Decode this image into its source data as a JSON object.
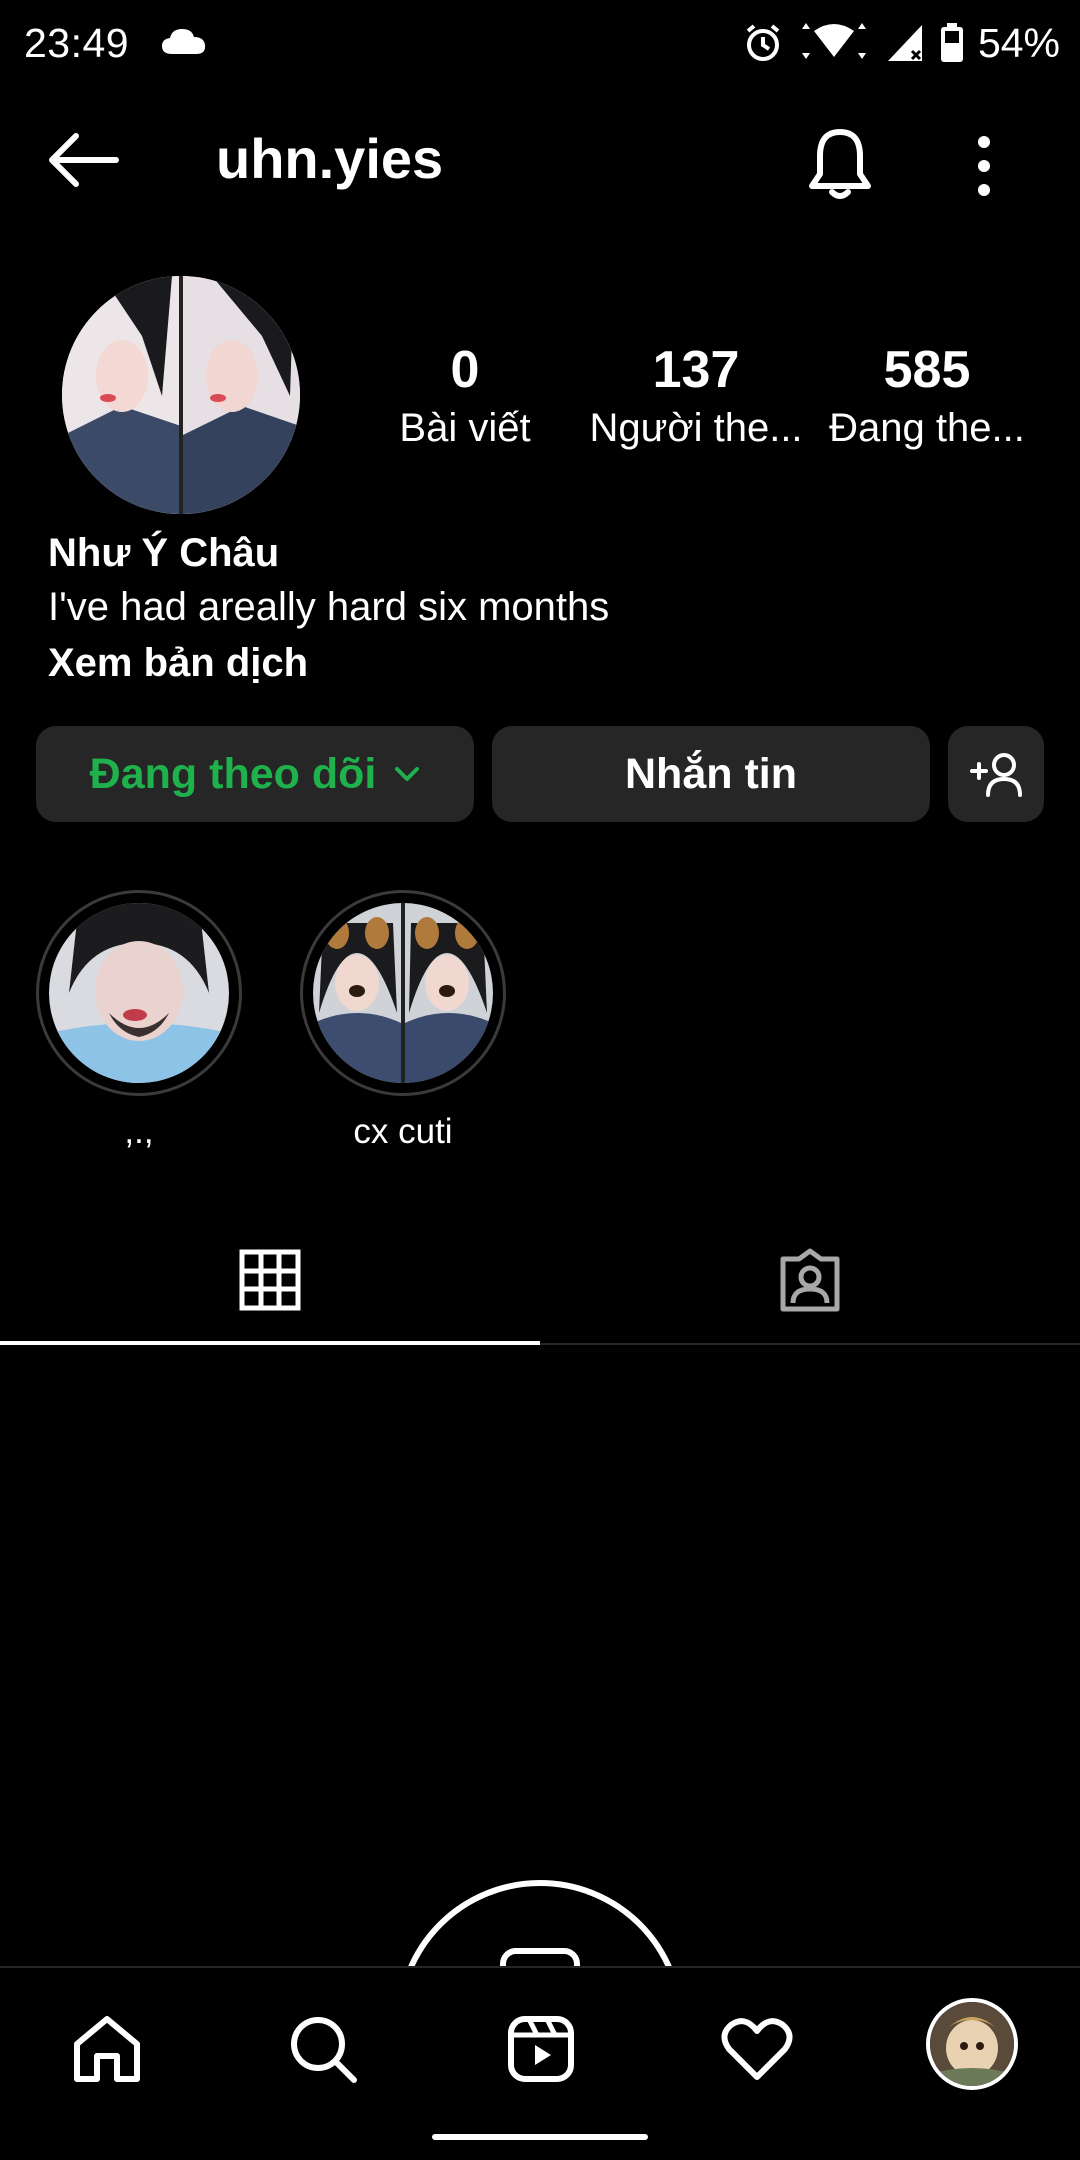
{
  "status_bar": {
    "time": "23:49",
    "battery_percent": "54%",
    "icons": [
      "cloud-icon",
      "alarm-icon",
      "wifi-icon",
      "cell-signal-icon",
      "battery-icon"
    ]
  },
  "header": {
    "username": "uhn.yies",
    "icons": [
      "back-arrow-icon",
      "bell-icon",
      "more-vertical-icon"
    ]
  },
  "profile": {
    "stats": [
      {
        "value": "0",
        "label": "Bài viết"
      },
      {
        "value": "137",
        "label": "Người the..."
      },
      {
        "value": "585",
        "label": "Đang the..."
      }
    ],
    "full_name": "Như Ý Châu",
    "bio": "I've had areally hard six months",
    "translate_label": "Xem bản dịch"
  },
  "actions": {
    "following_label": "Đang theo dõi",
    "message_label": "Nhắn tin"
  },
  "highlights": [
    {
      "label": ",.,"
    },
    {
      "label": "cx cuti"
    }
  ],
  "tabs": [
    "grid-icon",
    "tagged-icon"
  ],
  "bottom_nav": [
    "home-icon",
    "search-icon",
    "reels-icon",
    "heart-icon",
    "profile-avatar"
  ],
  "colors": {
    "background": "#000000",
    "button_bg": "#262626",
    "following_green": "#1fb14c",
    "text": "#ffffff"
  }
}
